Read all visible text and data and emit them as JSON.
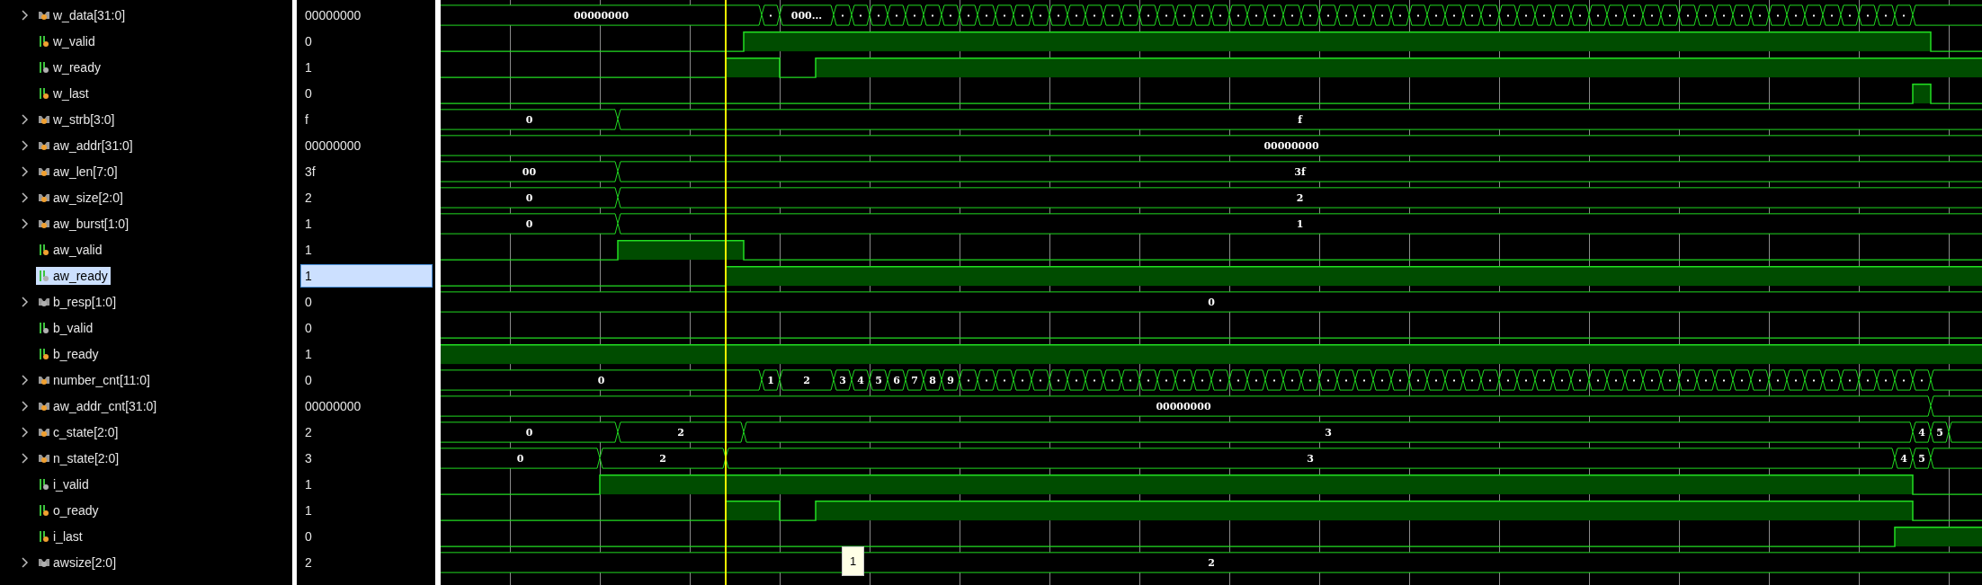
{
  "signals": [
    {
      "name": "w_data[31:0]",
      "kind": "bus",
      "expanded": false,
      "color": "#f0a030",
      "value": "00000000",
      "selected": false,
      "wave_labels": [
        "00000000",
        "000..."
      ]
    },
    {
      "name": "w_valid",
      "kind": "bit",
      "color": "#f0a030",
      "value": "0",
      "selected": false
    },
    {
      "name": "w_ready",
      "kind": "bit",
      "color": "#b0b0b0",
      "value": "1",
      "selected": false
    },
    {
      "name": "w_last",
      "kind": "bit",
      "color": "#f0a030",
      "value": "0",
      "selected": false
    },
    {
      "name": "w_strb[3:0]",
      "kind": "bus",
      "expanded": false,
      "color": "#f0a030",
      "value": "f",
      "selected": false,
      "wave_labels": [
        "0",
        "f"
      ]
    },
    {
      "name": "aw_addr[31:0]",
      "kind": "bus",
      "expanded": false,
      "color": "#f0a030",
      "value": "00000000",
      "selected": false,
      "wave_labels": [
        "00000000"
      ]
    },
    {
      "name": "aw_len[7:0]",
      "kind": "bus",
      "expanded": false,
      "color": "#f0a030",
      "value": "3f",
      "selected": false,
      "wave_labels": [
        "00",
        "3f"
      ]
    },
    {
      "name": "aw_size[2:0]",
      "kind": "bus",
      "expanded": false,
      "color": "#f0a030",
      "value": "2",
      "selected": false,
      "wave_labels": [
        "0",
        "2"
      ]
    },
    {
      "name": "aw_burst[1:0]",
      "kind": "bus",
      "expanded": false,
      "color": "#f0a030",
      "value": "1",
      "selected": false,
      "wave_labels": [
        "0",
        "1"
      ]
    },
    {
      "name": "aw_valid",
      "kind": "bit",
      "color": "#f0a030",
      "value": "1",
      "selected": false
    },
    {
      "name": "aw_ready",
      "kind": "bit",
      "color": "#b0b0b0",
      "value": "1",
      "selected": true
    },
    {
      "name": "b_resp[1:0]",
      "kind": "bus",
      "expanded": false,
      "color": "#b0b0b0",
      "value": "0",
      "selected": false,
      "wave_labels": [
        "0"
      ]
    },
    {
      "name": "b_valid",
      "kind": "bit",
      "color": "#b0b0b0",
      "value": "0",
      "selected": false
    },
    {
      "name": "b_ready",
      "kind": "bit",
      "color": "#f0a030",
      "value": "1",
      "selected": false
    },
    {
      "name": "number_cnt[11:0]",
      "kind": "bus",
      "expanded": false,
      "color": "#f0a030",
      "value": "0",
      "selected": false,
      "wave_labels": [
        "0",
        "1",
        "2",
        "3",
        "4",
        "5",
        "6",
        "7",
        "8",
        "9"
      ]
    },
    {
      "name": "aw_addr_cnt[31:0]",
      "kind": "bus",
      "expanded": false,
      "color": "#f0a030",
      "value": "00000000",
      "selected": false,
      "wave_labels": [
        "00000000"
      ]
    },
    {
      "name": "c_state[2:0]",
      "kind": "bus",
      "expanded": false,
      "color": "#f0a030",
      "value": "2",
      "selected": false,
      "wave_labels": [
        "0",
        "2",
        "3",
        "4",
        "5"
      ]
    },
    {
      "name": "n_state[2:0]",
      "kind": "bus",
      "expanded": false,
      "color": "#f0a030",
      "value": "3",
      "selected": false,
      "wave_labels": [
        "0",
        "2",
        "3",
        "4",
        "5"
      ]
    },
    {
      "name": "i_valid",
      "kind": "bit",
      "color": "#b0b0b0",
      "value": "1",
      "selected": false
    },
    {
      "name": "o_ready",
      "kind": "bit",
      "color": "#f0a030",
      "value": "1",
      "selected": false
    },
    {
      "name": "i_last",
      "kind": "bit",
      "color": "#f0a030",
      "value": "0",
      "selected": false
    },
    {
      "name": "awsize[2:0]",
      "kind": "bus",
      "expanded": false,
      "color": "#b0b0b0",
      "value": "2",
      "selected": false,
      "wave_labels": [
        "2"
      ]
    }
  ],
  "cursor_tooltip": "1"
}
